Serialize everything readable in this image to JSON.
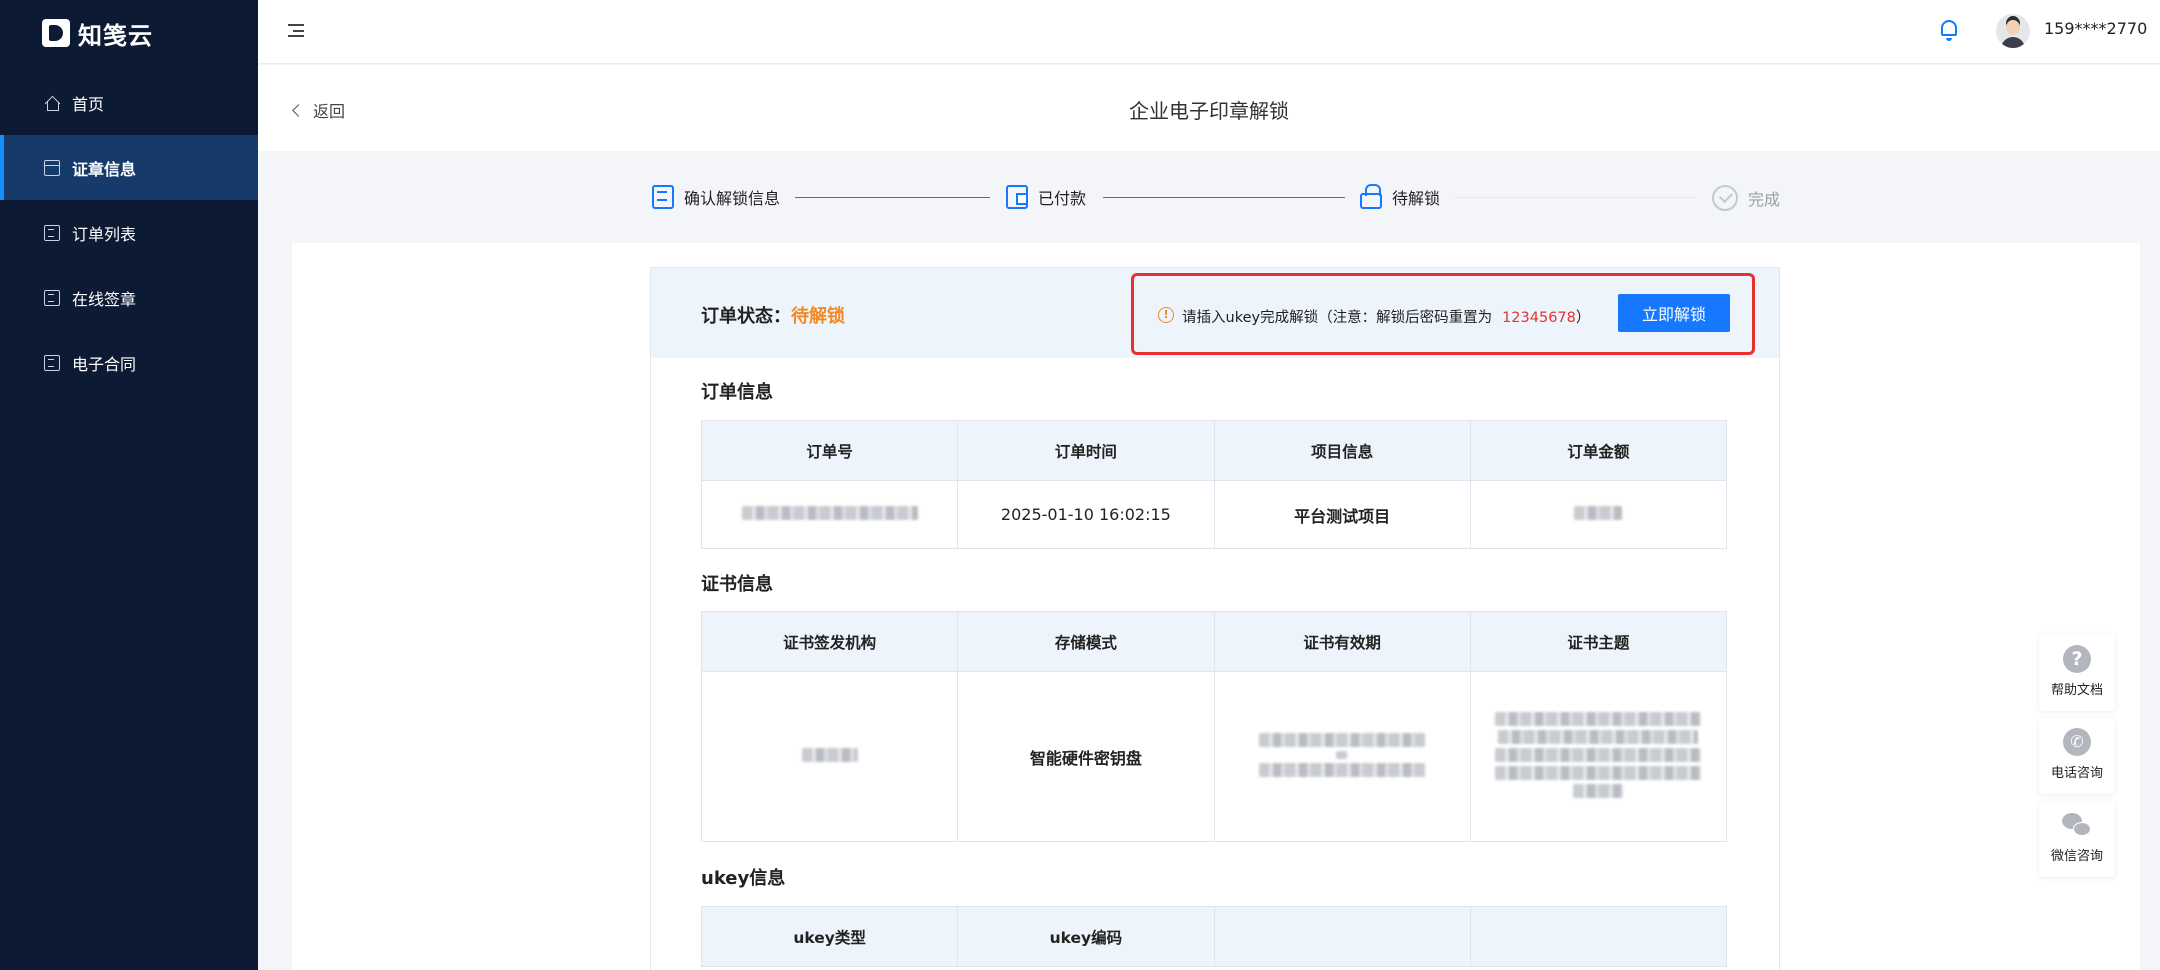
{
  "app": {
    "name": "知笺云"
  },
  "sidebar": {
    "items": [
      {
        "label": "首页",
        "icon": "home-icon"
      },
      {
        "label": "证章信息",
        "icon": "calendar-icon",
        "active": true
      },
      {
        "label": "订单列表",
        "icon": "list-icon"
      },
      {
        "label": "在线签章",
        "icon": "list-icon"
      },
      {
        "label": "电子合同",
        "icon": "document-icon"
      }
    ]
  },
  "header": {
    "user_phone": "159****2770",
    "icons": [
      "menu-fold-icon",
      "bell-icon",
      "avatar"
    ]
  },
  "titlebar": {
    "back_label": "返回",
    "page_title": "企业电子印章解锁"
  },
  "steps": [
    {
      "label": "确认解锁信息",
      "state": "done"
    },
    {
      "label": "已付款",
      "state": "done"
    },
    {
      "label": "待解锁",
      "state": "current"
    },
    {
      "label": "完成",
      "state": "pending"
    }
  ],
  "status": {
    "label": "订单状态：",
    "value": "待解锁",
    "value_color": "#f08a24"
  },
  "alert": {
    "text": "请插入ukey完成解锁（注意：解锁后密码重置为",
    "password": "12345678",
    "suffix": "）",
    "button_label": "立即解锁"
  },
  "order_info": {
    "title": "订单信息",
    "headers": [
      "订单号",
      "订单时间",
      "项目信息",
      "订单金额"
    ],
    "row": {
      "order_time": "2025-01-10 16:02:15",
      "project": "平台测试项目"
    }
  },
  "cert_info": {
    "title": "证书信息",
    "headers": [
      "证书签发机构",
      "存储模式",
      "证书有效期",
      "证书主题"
    ],
    "row": {
      "storage_mode": "智能硬件密钥盘"
    }
  },
  "ukey_info": {
    "title": "ukey信息",
    "headers": [
      "ukey类型",
      "ukey编码",
      "",
      ""
    ]
  },
  "float_actions": [
    {
      "label": "帮助文档",
      "icon": "question-icon"
    },
    {
      "label": "电话咨询",
      "icon": "phone-icon"
    },
    {
      "label": "微信咨询",
      "icon": "wechat-icon"
    }
  ],
  "colors": {
    "accent": "#1677ff",
    "sidebar_bg": "#0c1a33",
    "alert_border": "#e8302f",
    "status": "#f08a24"
  }
}
